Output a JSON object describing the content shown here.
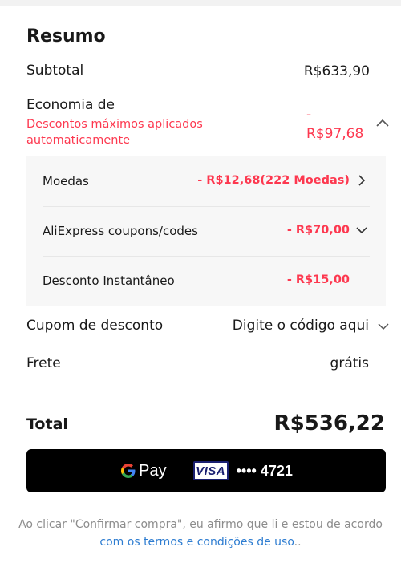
{
  "summary": {
    "title": "Resumo",
    "subtotal_label": "Subtotal",
    "subtotal_value": "R$633,90",
    "economia_label": "Economia de",
    "economia_note": "Descontos máximos aplicados automaticamente",
    "economia_value_sign": "-",
    "economia_value": "R$97,68",
    "discounts": [
      {
        "label": "Moedas",
        "value": "- R$12,68(222 Moedas)",
        "icon": "chevron-right-icon"
      },
      {
        "label": "AliExpress coupons/codes",
        "value": "- R$70,00",
        "icon": "chevron-down-icon"
      },
      {
        "label": "Desconto Instantâneo",
        "value": "- R$15,00",
        "icon": ""
      }
    ],
    "coupon_label": "Cupom de desconto",
    "coupon_placeholder": "Digite o código aqui",
    "shipping_label": "Frete",
    "shipping_value": "grátis",
    "total_label": "Total",
    "total_value": "R$536,22"
  },
  "payment": {
    "gpay_text": "Pay",
    "card_brand": "VISA",
    "card_number": "•••• 4721"
  },
  "terms": {
    "prefix": "Ao clicar \"Confirmar compra\", eu afirmo que li e estou de acordo ",
    "link": "com os termos e condições de uso",
    "suffix": ".."
  },
  "colors": {
    "accent_red": "#fd384f",
    "link_blue": "#2e7dd1",
    "panel_bg": "#f7f7f7"
  }
}
